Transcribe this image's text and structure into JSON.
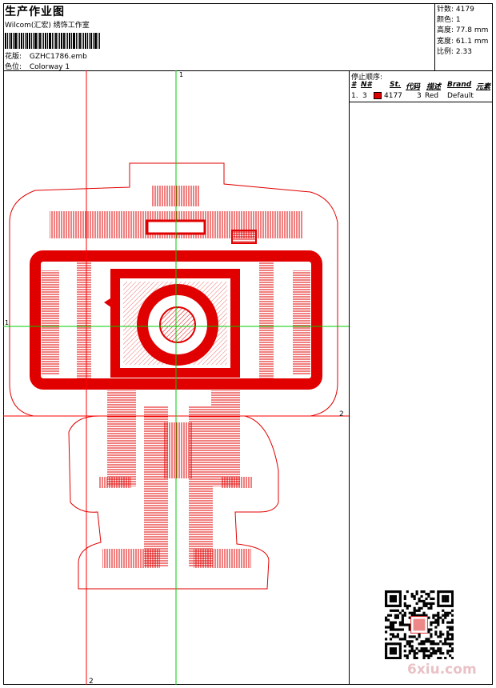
{
  "header": {
    "title": "生产作业图",
    "studio": "Wilcom(汇宏) 绣饰工作室",
    "design_label": "花版:",
    "design_file": "GZHC1786.emb",
    "colorway_label": "色位:",
    "colorway": "Colorway 1"
  },
  "stats": {
    "stitches_label": "针数:",
    "stitches": "4179",
    "colors_label": "颜色:",
    "colors": "1",
    "height_label": "高度:",
    "height": "77.8 mm",
    "width_label": "宽度:",
    "width": "61.1 mm",
    "ratio_label": "比例:",
    "ratio": "2.33"
  },
  "stop_sequence": {
    "title": "停止顺序:",
    "columns": [
      "#",
      "N#",
      "St.",
      "代码",
      "描述",
      "Brand",
      "元素"
    ],
    "rows": [
      {
        "index": "1.",
        "needle": "3",
        "stitches": "4177",
        "code": "3",
        "description": "Red",
        "brand": "Default",
        "color": "#e00000"
      }
    ]
  },
  "guides": {
    "marker_1": "1",
    "marker_2": "2"
  },
  "watermark": "6xiu.com",
  "colors": {
    "thread": "#e00000",
    "guide_red": "#ff0000",
    "guide_green": "#00cc00"
  }
}
